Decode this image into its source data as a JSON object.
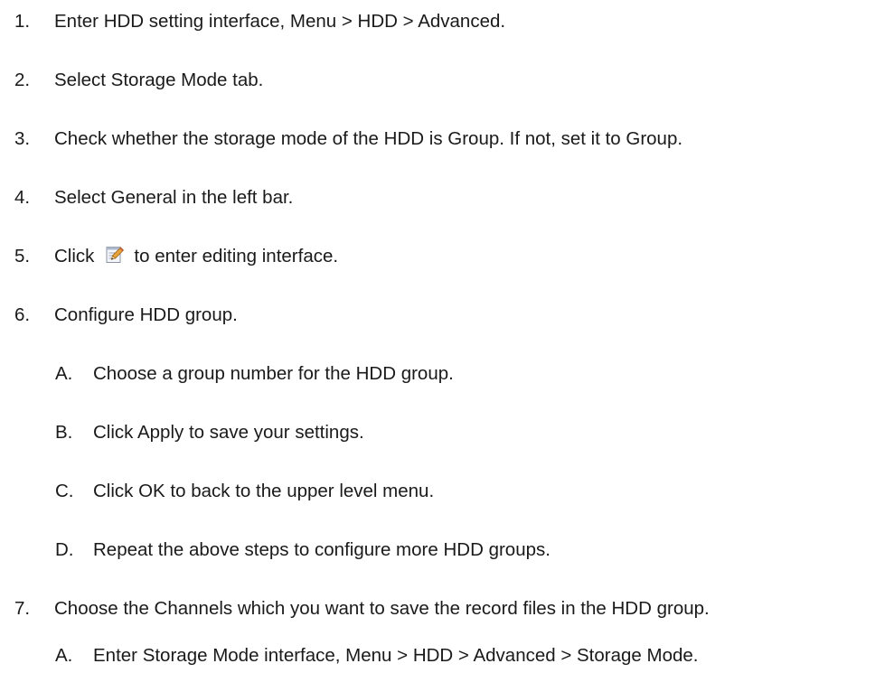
{
  "steps": [
    {
      "num": "1.",
      "text": "Enter HDD setting interface, Menu > HDD > Advanced."
    },
    {
      "num": "2.",
      "text": "Select Storage Mode tab."
    },
    {
      "num": "3.",
      "text": "Check whether the storage mode of the HDD is Group. If not, set it to Group."
    },
    {
      "num": "4.",
      "text": "Select General in the left bar."
    },
    {
      "num": "5.",
      "text_before": "Click",
      "icon": "edit-icon",
      "text_after": "to enter editing interface."
    },
    {
      "num": "6.",
      "text": "Configure HDD group."
    },
    {
      "num": "7.",
      "text": "Choose the Channels which you want to save the record files in the HDD group."
    }
  ],
  "substeps_6": [
    {
      "num": "A.",
      "text": "Choose a group number for the HDD group."
    },
    {
      "num": "B.",
      "text": "Click Apply to save your settings."
    },
    {
      "num": "C.",
      "text": "Click OK to back to the upper level menu."
    },
    {
      "num": "D.",
      "text": "Repeat the above steps to configure more HDD groups."
    }
  ],
  "substeps_7": [
    {
      "num": "A.",
      "text": "Enter Storage Mode interface, Menu > HDD > Advanced > Storage Mode."
    }
  ]
}
